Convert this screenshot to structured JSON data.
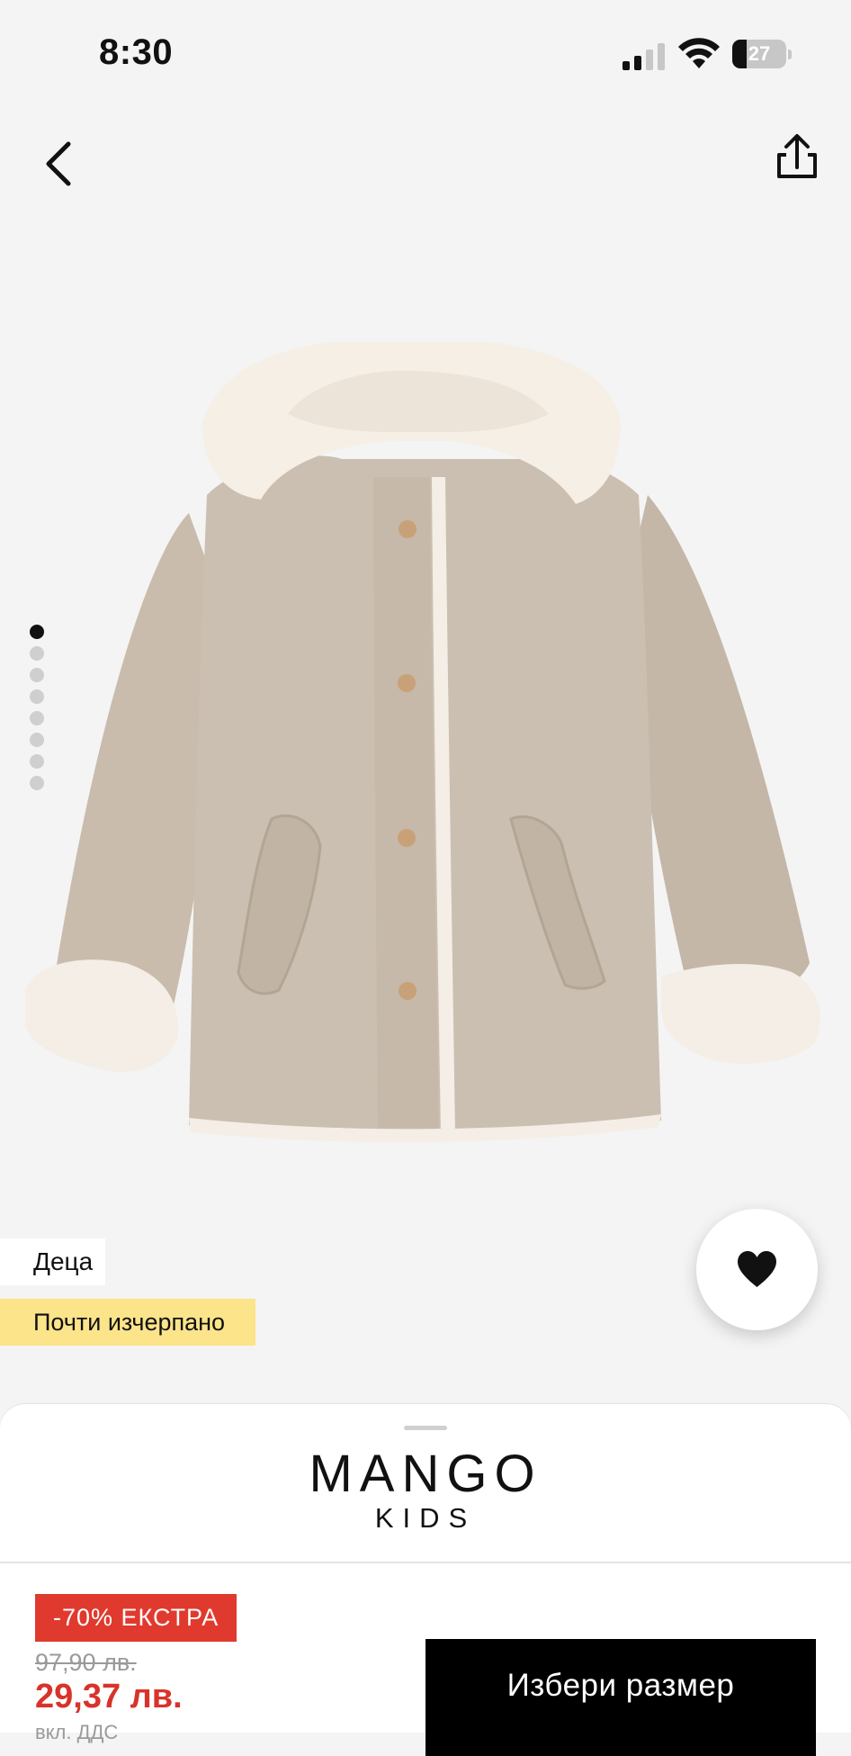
{
  "status_bar": {
    "time": "8:30",
    "battery_level": "27",
    "battery_fraction": 0.27
  },
  "nav": {
    "back_icon": "chevron-left-icon",
    "share_icon": "share-icon"
  },
  "carousel": {
    "image_count": 8,
    "active_index": 0
  },
  "tags": {
    "category": "Деца",
    "stock": "Почти изчерпано"
  },
  "favorite": {
    "icon": "heart-icon"
  },
  "brand": {
    "name": "MANGO",
    "sub": "KIDS"
  },
  "pricing": {
    "discount_badge": "-70% ЕКСТРА",
    "old_price": "97,90 лв.",
    "new_price": "29,37 лв.",
    "vat_note": "вкл. ДДС"
  },
  "actions": {
    "select_size": "Избери размер"
  },
  "colors": {
    "background": "#f4f4f4",
    "discount": "#e03a2f",
    "sale_price": "#d8332a",
    "stock_tag": "#fbe48a",
    "primary_button": "#000000"
  }
}
